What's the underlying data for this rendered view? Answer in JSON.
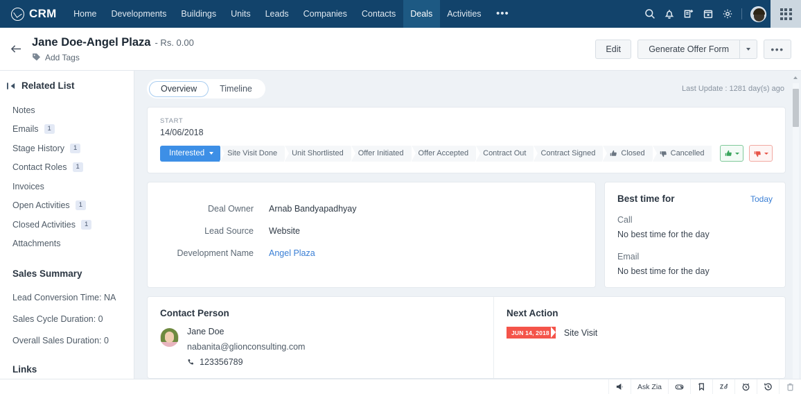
{
  "topnav": {
    "brand": "CRM",
    "items": [
      {
        "label": "Home",
        "active": false
      },
      {
        "label": "Developments",
        "active": false
      },
      {
        "label": "Buildings",
        "active": false
      },
      {
        "label": "Units",
        "active": false
      },
      {
        "label": "Leads",
        "active": false
      },
      {
        "label": "Companies",
        "active": false
      },
      {
        "label": "Contacts",
        "active": false
      },
      {
        "label": "Deals",
        "active": true
      },
      {
        "label": "Activities",
        "active": false
      }
    ],
    "more": "•••",
    "icons": [
      "search-icon",
      "notification-bell-icon",
      "add-note-icon",
      "calendar-icon",
      "settings-gear-icon"
    ]
  },
  "titlebar": {
    "deal_title": "Jane Doe-Angel Plaza",
    "amount": "- Rs. 0.00",
    "add_tags": "Add Tags",
    "edit_label": "Edit",
    "generate_label": "Generate Offer Form",
    "more_label": "•••"
  },
  "sidebar": {
    "title": "Related List",
    "items": [
      {
        "label": "Notes",
        "count": ""
      },
      {
        "label": "Emails",
        "count": "1"
      },
      {
        "label": "Stage History",
        "count": "1"
      },
      {
        "label": "Contact Roles",
        "count": "1"
      },
      {
        "label": "Invoices",
        "count": ""
      },
      {
        "label": "Open Activities",
        "count": "1"
      },
      {
        "label": "Closed Activities",
        "count": "1"
      },
      {
        "label": "Attachments",
        "count": ""
      }
    ],
    "sales_summary_title": "Sales Summary",
    "stats": [
      "Lead Conversion Time: NA",
      "Sales Cycle Duration: 0",
      "Overall Sales Duration: 0"
    ],
    "links_title": "Links"
  },
  "main": {
    "tabs": [
      {
        "label": "Overview",
        "active": true
      },
      {
        "label": "Timeline",
        "active": false
      }
    ],
    "last_update": "Last Update : 1281 day(s) ago",
    "stage": {
      "start_label": "START",
      "start_date": "14/06/2018",
      "stages": [
        {
          "label": "Interested",
          "active": true,
          "icon": ""
        },
        {
          "label": "Site Visit Done",
          "active": false,
          "icon": ""
        },
        {
          "label": "Unit Shortlisted",
          "active": false,
          "icon": ""
        },
        {
          "label": "Offer Initiated",
          "active": false,
          "icon": ""
        },
        {
          "label": "Offer Accepted",
          "active": false,
          "icon": ""
        },
        {
          "label": "Contract Out",
          "active": false,
          "icon": ""
        },
        {
          "label": "Contract Signed",
          "active": false,
          "icon": ""
        },
        {
          "label": "Closed",
          "active": false,
          "icon": "thumbs-up-icon"
        },
        {
          "label": "Cancelled",
          "active": false,
          "icon": "thumbs-down-icon"
        }
      ]
    },
    "details": {
      "fields": [
        {
          "label": "Deal Owner",
          "value": "Arnab Bandyapadhyay",
          "link": false
        },
        {
          "label": "Lead Source",
          "value": "Website",
          "link": false
        },
        {
          "label": "Development Name",
          "value": "Angel Plaza",
          "link": true
        }
      ]
    },
    "best_time": {
      "title": "Best time for",
      "today": "Today",
      "call_label": "Call",
      "call_value": "No best time for the day",
      "email_label": "Email",
      "email_value": "No best time for the day"
    },
    "contact_person": {
      "title": "Contact Person",
      "name": "Jane Doe",
      "email": "nabanita@glionconsulting.com",
      "phone": "123356789"
    },
    "next_action": {
      "title": "Next Action",
      "date": "JUN 14, 2018",
      "action": "Site Visit"
    }
  },
  "bottombar": {
    "ask_zia": "Ask Zia",
    "icons": [
      "megaphone-icon",
      "gamepad-icon",
      "bookmark-icon",
      "zia-icon",
      "alarm-clock-icon",
      "history-icon",
      "trash-icon"
    ]
  },
  "colors": {
    "nav_bg": "#12436b",
    "nav_active": "#1d5983",
    "accent_blue": "#3d8fe6",
    "link_blue": "#3a7fd5",
    "ribbon_red": "#f4544a",
    "page_bg": "#eef2f6"
  }
}
